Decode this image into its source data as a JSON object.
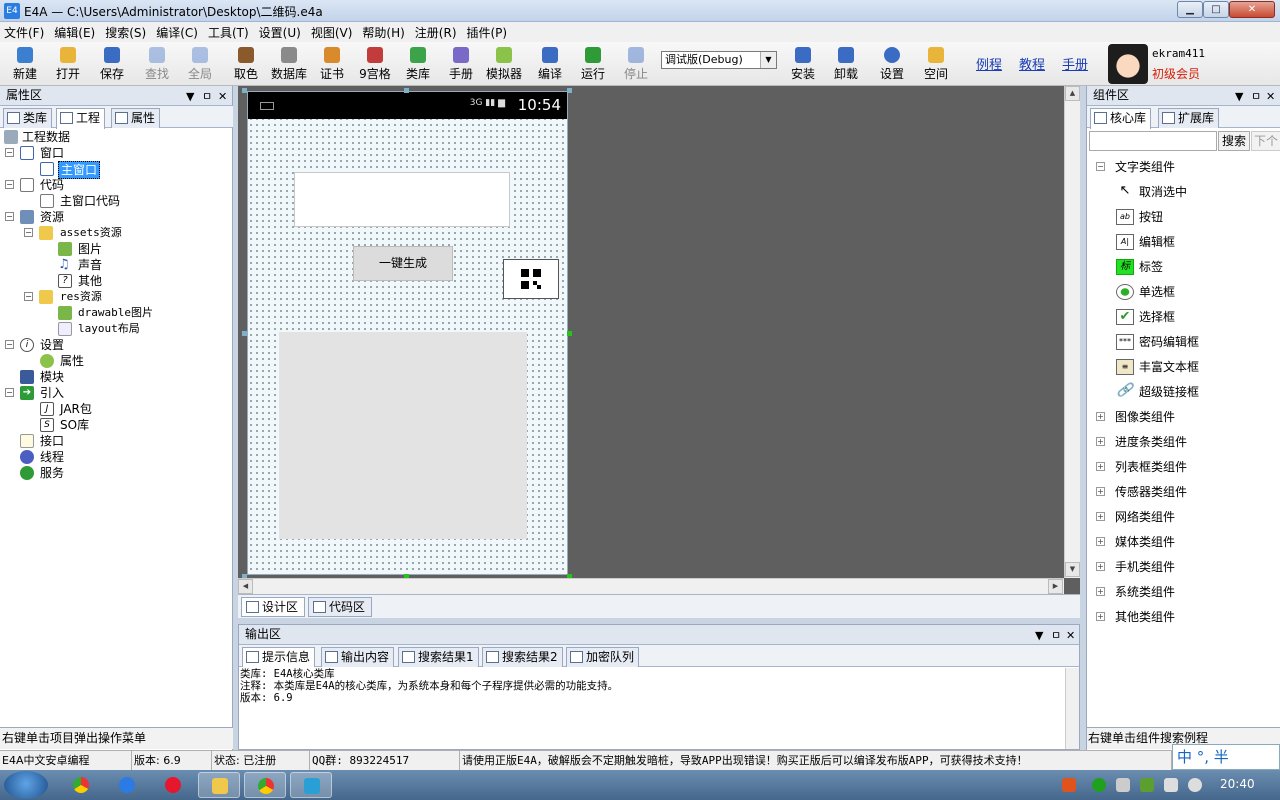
{
  "window": {
    "title": "E4A — C:\\Users\\Administrator\\Desktop\\二维码.e4a",
    "controls": {
      "minimize": "▁",
      "maximize": "□",
      "close": "✕"
    }
  },
  "menu": [
    "文件(F)",
    "编辑(E)",
    "搜索(S)",
    "编译(C)",
    "工具(T)",
    "设置(U)",
    "视图(V)",
    "帮助(H)",
    "注册(R)",
    "插件(P)"
  ],
  "toolbar": {
    "buttons": [
      {
        "label": "新建",
        "icon": "new-file-icon",
        "color": "#3c7fd1"
      },
      {
        "label": "打开",
        "icon": "open-folder-icon",
        "color": "#e8b43a"
      },
      {
        "label": "保存",
        "icon": "save-icon",
        "color": "#3b6cc4"
      },
      {
        "label": "查找",
        "icon": "search-icon",
        "color": "#4f7fc9"
      },
      {
        "label": "全局",
        "icon": "global-icon",
        "color": "#4f7fc9"
      },
      {
        "label": "取色",
        "icon": "color-picker-icon",
        "color": "#8b5a2b"
      },
      {
        "label": "数据库",
        "icon": "database-icon",
        "color": "#8a8a8a"
      },
      {
        "label": "证书",
        "icon": "certificate-icon",
        "color": "#d98a2c"
      },
      {
        "label": "9宫格",
        "icon": "grid-icon",
        "color": "#c23c3c"
      },
      {
        "label": "类库",
        "icon": "library-icon",
        "color": "#3da34a"
      },
      {
        "label": "手册",
        "icon": "manual-icon",
        "color": "#7a69c7"
      },
      {
        "label": "模拟器",
        "icon": "android-icon",
        "color": "#8bc34a"
      },
      {
        "label": "编译",
        "icon": "compile-icon",
        "color": "#3b6cc4"
      },
      {
        "label": "运行",
        "icon": "run-icon",
        "color": "#2e9b36"
      },
      {
        "label": "停止",
        "icon": "stop-icon",
        "color": "#3b6cc4"
      },
      {
        "label": "安装",
        "icon": "install-icon",
        "color": "#3b6cc4"
      },
      {
        "label": "卸载",
        "icon": "uninstall-icon",
        "color": "#3b6cc4"
      },
      {
        "label": "设置",
        "icon": "info-settings-icon",
        "color": "#3b6cc4"
      },
      {
        "label": "空间",
        "icon": "space-folder-icon",
        "color": "#e8b43a"
      }
    ],
    "debug_select": "调试版(Debug)",
    "links": [
      "例程",
      "教程",
      "手册"
    ],
    "user": {
      "name": "ekram411",
      "level": "初级会员",
      "level_color": "#d81e06"
    }
  },
  "left_panel": {
    "title": "属性区",
    "controls": "▼ ㅁ ✕",
    "tabs": [
      "类库",
      "工程",
      "属性"
    ],
    "active_tab": "工程",
    "tree": [
      {
        "label": "工程数据",
        "icon": "project-icon"
      },
      {
        "label": "窗口",
        "icon": "window-icon"
      },
      {
        "label": "主窗口",
        "icon": "window-icon",
        "selected": true
      },
      {
        "label": "代码",
        "icon": "code-icon"
      },
      {
        "label": "主窗口代码",
        "icon": "code-file-icon"
      },
      {
        "label": "资源",
        "icon": "resources-icon"
      },
      {
        "label": "assets资源",
        "icon": "folder-icon"
      },
      {
        "label": "图片",
        "icon": "image-icon"
      },
      {
        "label": "声音",
        "icon": "music-icon"
      },
      {
        "label": "其他",
        "icon": "question-icon"
      },
      {
        "label": "res资源",
        "icon": "folder-icon"
      },
      {
        "label": "drawable图片",
        "icon": "image-icon"
      },
      {
        "label": "layout布局",
        "icon": "layout-icon"
      },
      {
        "label": "设置",
        "icon": "info-icon"
      },
      {
        "label": "属性",
        "icon": "android-icon"
      },
      {
        "label": "模块",
        "icon": "module-icon"
      },
      {
        "label": "引入",
        "icon": "import-icon"
      },
      {
        "label": "JAR包",
        "icon": "jar-icon"
      },
      {
        "label": "SO库",
        "icon": "so-icon"
      },
      {
        "label": "接口",
        "icon": "interface-icon"
      },
      {
        "label": "线程",
        "icon": "thread-icon"
      },
      {
        "label": "服务",
        "icon": "service-icon"
      }
    ],
    "status": "右键单击项目弹出操作菜单"
  },
  "designer": {
    "phone_time": "10:54",
    "phone_signal": "3G",
    "generate_button": "一键生成",
    "tabs": [
      "设计区",
      "代码区"
    ]
  },
  "output": {
    "title": "输出区",
    "tabs": [
      "提示信息",
      "输出内容",
      "搜索结果1",
      "搜索结果2",
      "加密队列"
    ],
    "lines": [
      "类库: E4A核心类库",
      "注释: 本类库是E4A的核心类库，为系统本身和每个子程序提供必需的功能支持。",
      "版本: 6.9"
    ]
  },
  "right_panel": {
    "title": "组件区",
    "tabs": [
      "核心库",
      "扩展库"
    ],
    "search_button": "搜索",
    "next_button": "下个",
    "groups_top": "文字类组件",
    "components": [
      {
        "label": "取消选中",
        "icon": "cursor-icon"
      },
      {
        "label": "按钮",
        "icon": "button-ab-icon"
      },
      {
        "label": "编辑框",
        "icon": "edit-box-icon"
      },
      {
        "label": "标签",
        "icon": "label-icon"
      },
      {
        "label": "单选框",
        "icon": "radio-icon"
      },
      {
        "label": "选择框",
        "icon": "checkbox-icon"
      },
      {
        "label": "密码编辑框",
        "icon": "password-icon"
      },
      {
        "label": "丰富文本框",
        "icon": "richtext-icon"
      },
      {
        "label": "超级链接框",
        "icon": "link-icon"
      }
    ],
    "groups": [
      "图像类组件",
      "进度条类组件",
      "列表框类组件",
      "传感器类组件",
      "网络类组件",
      "媒体类组件",
      "手机类组件",
      "系统类组件",
      "其他类组件"
    ],
    "status": "右键单击组件搜索例程"
  },
  "statusbar": {
    "lang": "E4A中文安卓编程",
    "version": "版本: 6.9",
    "state": "状态: 已注册",
    "qq": "QQ群: 893224517",
    "warning": "请使用正版E4A，破解版会不定期触发暗桩，导致APP出现错误！购买正版后可以编译发布版APP，可获得技术支持！"
  },
  "ime": "中 °, 半",
  "taskbar": {
    "time": "20:40"
  }
}
